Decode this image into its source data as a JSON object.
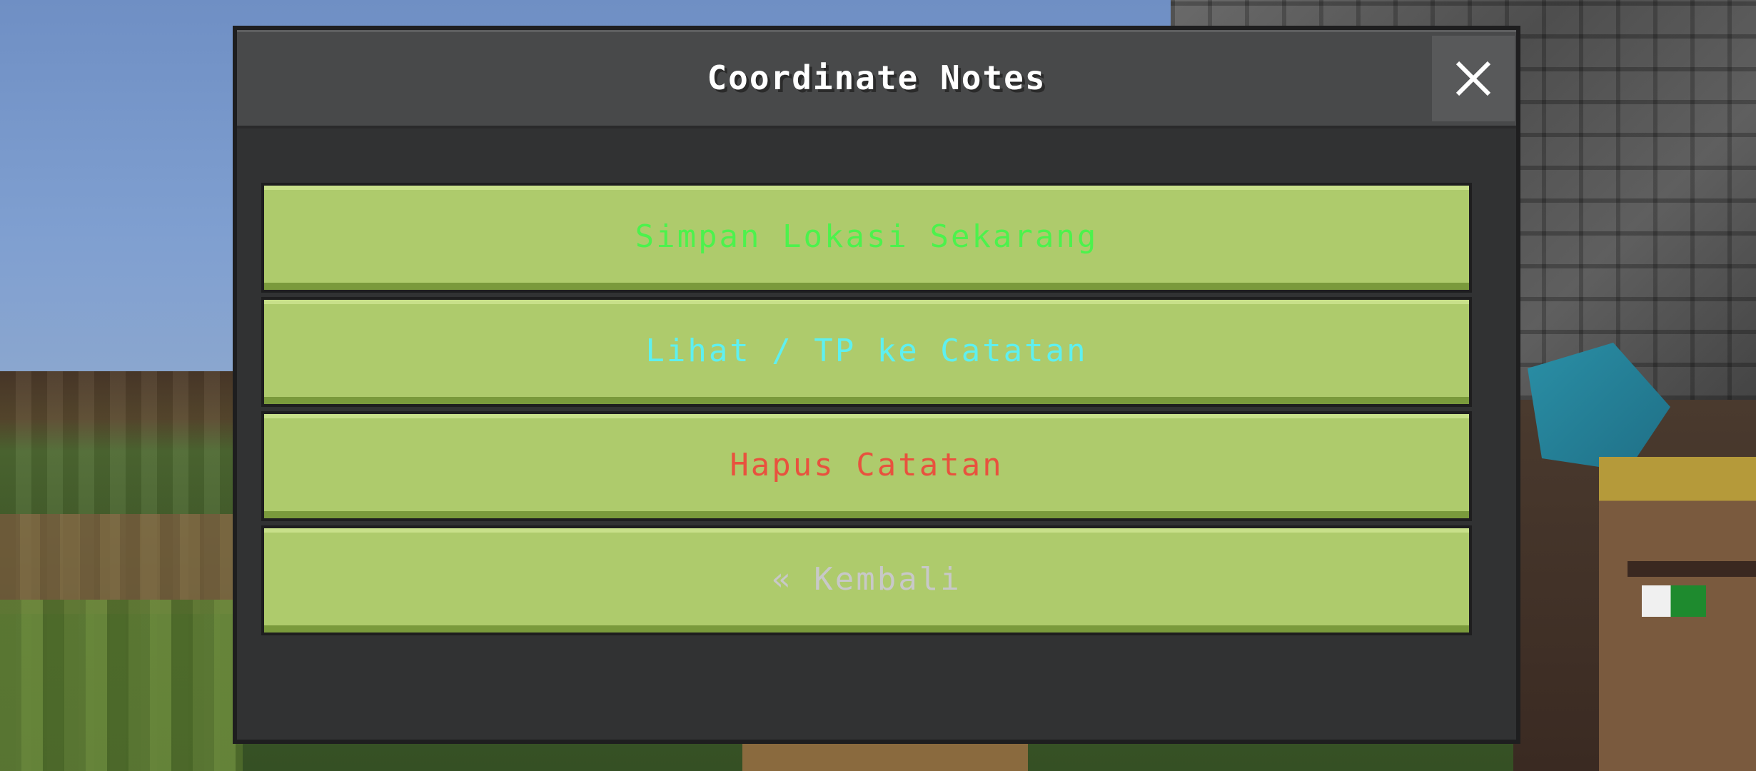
{
  "dialog": {
    "title": "Coordinate Notes",
    "close_icon": "close-icon"
  },
  "buttons": [
    {
      "label": "Simpan Lokasi Sekarang",
      "color": "#4cf24c"
    },
    {
      "label": "Lihat / TP ke Catatan",
      "color": "#5ef0f0"
    },
    {
      "label": "Hapus Catatan",
      "color": "#e8523e"
    },
    {
      "label": "« Kembali",
      "color": "#c8c8c8"
    }
  ],
  "colors": {
    "button_face": "#aecb6c",
    "panel": "#313233",
    "header": "#48494a"
  }
}
